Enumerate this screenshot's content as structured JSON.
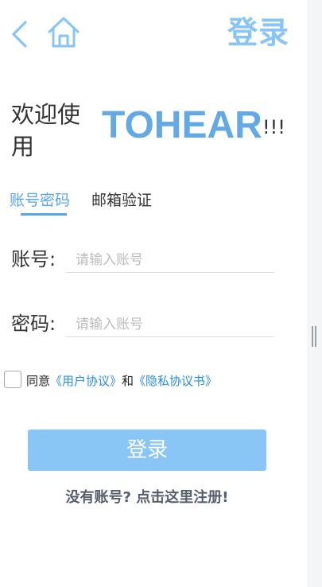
{
  "header": {
    "title": "登录",
    "back_icon": "chevron-left-icon",
    "home_icon": "home-icon",
    "accent_color": "#88c5f6"
  },
  "welcome": {
    "text": "欢迎使用",
    "brand": "TOHEAR",
    "exclaim": "!!!",
    "brand_color": "#63a9e6"
  },
  "tabs": [
    {
      "label": "账号密码",
      "active": true
    },
    {
      "label": "邮箱验证",
      "active": false
    }
  ],
  "form": {
    "account_label": "账号:",
    "account_placeholder": "请输入账号",
    "account_value": "",
    "password_label": "密码:",
    "password_placeholder": "请输入账号",
    "password_value": ""
  },
  "agreement": {
    "checked": false,
    "prefix": "同意",
    "user_agreement": "《用户协议》",
    "conjunction": "和",
    "privacy_agreement": "《隐私协议书》",
    "link_color": "#2a8fd8"
  },
  "login_button": {
    "label": "登录",
    "color": "#8ac6f5"
  },
  "register": {
    "label": "没有账号? 点击这里注册!"
  }
}
